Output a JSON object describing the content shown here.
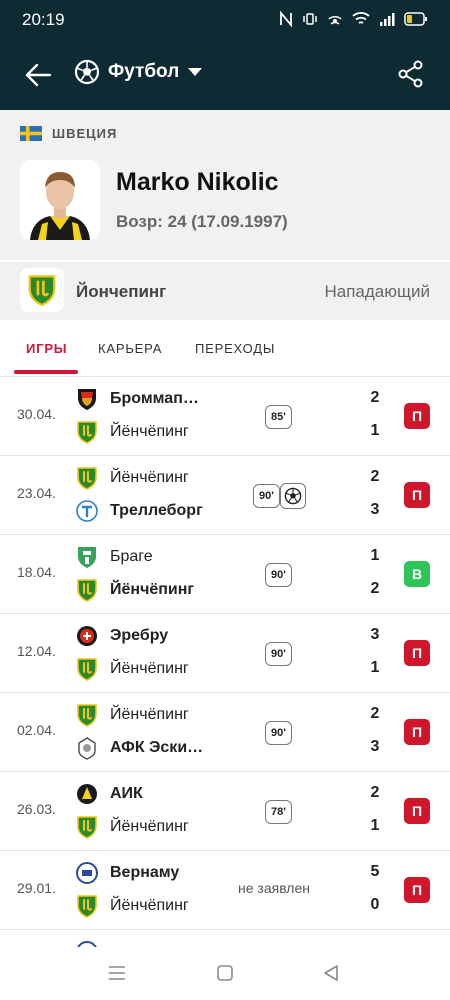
{
  "status_bar": {
    "time": "20:19"
  },
  "app_bar": {
    "sport": "Футбол"
  },
  "player": {
    "country": "ШВЕЦИЯ",
    "name": "Marko Nikolic",
    "age_line": "Возр: 24 (17.09.1997)",
    "team": "Йончепинг",
    "position": "Нападающий"
  },
  "tabs": [
    {
      "label": "ИГРЫ",
      "active": true
    },
    {
      "label": "КАРЬЕРА",
      "active": false
    },
    {
      "label": "ПЕРЕХОДЫ",
      "active": false
    }
  ],
  "matches": [
    {
      "date": "30.04.",
      "home": "Броммап…",
      "away": "Йёнчёпинг",
      "home_score": "2",
      "away_score": "1",
      "minute": "85'",
      "result": "П"
    },
    {
      "date": "23.04.",
      "home": "Йёнчёпинг",
      "away": "Треллеборг",
      "home_score": "2",
      "away_score": "3",
      "minute": "90'",
      "result": "П"
    },
    {
      "date": "18.04.",
      "home": "Браге",
      "away": "Йёнчёпинг",
      "home_score": "1",
      "away_score": "2",
      "minute": "90'",
      "result": "В"
    },
    {
      "date": "12.04.",
      "home": "Эребру",
      "away": "Йёнчёпинг",
      "home_score": "3",
      "away_score": "1",
      "minute": "90'",
      "result": "П"
    },
    {
      "date": "02.04.",
      "home": "Йёнчёпинг",
      "away": "АФК Эски…",
      "home_score": "2",
      "away_score": "3",
      "minute": "90'",
      "result": "П"
    },
    {
      "date": "26.03.",
      "home": "АИК",
      "away": "Йёнчёпинг",
      "home_score": "2",
      "away_score": "1",
      "minute": "78'",
      "result": "П"
    },
    {
      "date": "29.01.",
      "home": "Вернаму",
      "away": "Йёнчёпинг",
      "home_score": "5",
      "away_score": "0",
      "note": "не заявлен",
      "result": "П"
    }
  ],
  "colors": {
    "header": "#0e2a33",
    "accent": "#d0163a",
    "loss": "#d0162a",
    "win": "#2fc457"
  }
}
